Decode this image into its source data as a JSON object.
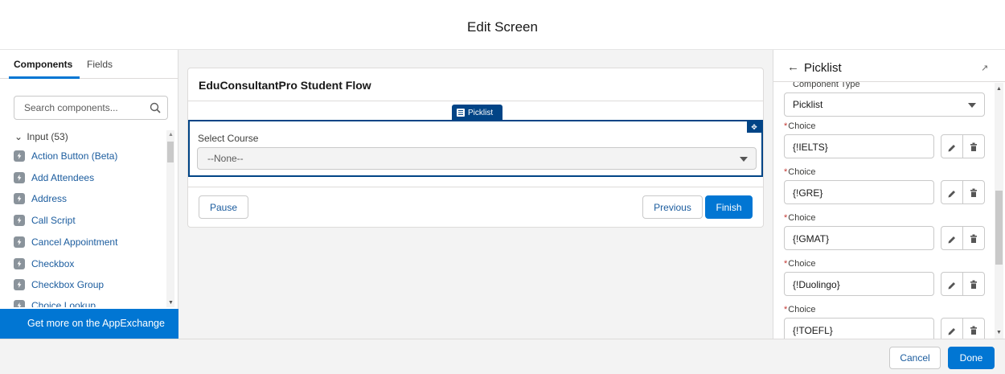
{
  "header": {
    "title": "Edit Screen"
  },
  "left_panel": {
    "tabs": [
      {
        "label": "Components",
        "active": true
      },
      {
        "label": "Fields",
        "active": false
      }
    ],
    "search": {
      "placeholder": "Search components...",
      "icon": "search-icon"
    },
    "section": {
      "label": "Input (53)",
      "icon": "chevron-down-icon"
    },
    "items": [
      {
        "label": "Action Button (Beta)",
        "icon": "lightning-icon"
      },
      {
        "label": "Add Attendees",
        "icon": "lightning-icon"
      },
      {
        "label": "Address",
        "icon": "location-icon"
      },
      {
        "label": "Call Script",
        "icon": "lightning-icon"
      },
      {
        "label": "Cancel Appointment",
        "icon": "lightning-icon"
      },
      {
        "label": "Checkbox",
        "icon": "checkbox-icon"
      },
      {
        "label": "Checkbox Group",
        "icon": "checkbox-group-icon"
      },
      {
        "label": "Choice Lookup",
        "icon": "lightning-icon"
      }
    ],
    "appexchange_label": "Get more on the AppExchange"
  },
  "canvas": {
    "flow_title": "EduConsultantPro Student Flow",
    "selected_tag": "Picklist",
    "field": {
      "label": "Select Course",
      "value": "--None--"
    },
    "buttons": {
      "pause": "Pause",
      "previous": "Previous",
      "finish": "Finish"
    }
  },
  "properties": {
    "title": "Picklist",
    "component_type_label": "Component Type",
    "component_type_value": "Picklist",
    "choice_label": "Choice",
    "choices": [
      "{!IELTS}",
      "{!GRE}",
      "{!GMAT}",
      "{!Duolingo}",
      "{!TOEFL}"
    ]
  },
  "footer": {
    "cancel": "Cancel",
    "done": "Done"
  },
  "colors": {
    "brand": "#0176d3",
    "selected": "#014486",
    "link": "#1b5c9e"
  }
}
